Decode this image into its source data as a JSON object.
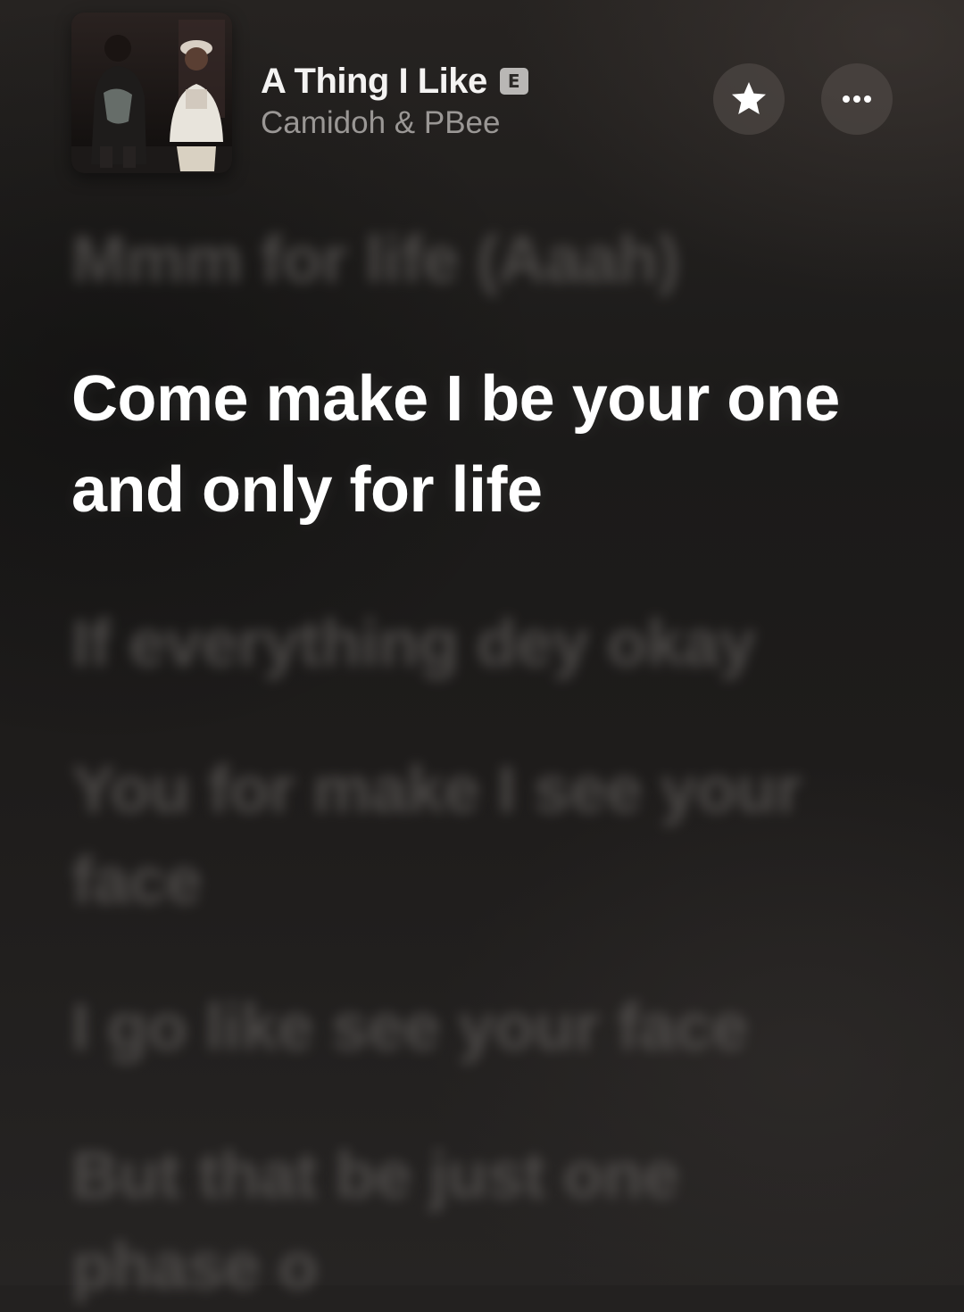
{
  "now_playing": {
    "title": "A Thing I Like",
    "explicit_label": "E",
    "artist": "Camidoh & PBee"
  },
  "actions": {
    "favorite_icon": "star-icon",
    "more_icon": "ellipsis-icon"
  },
  "lyrics": {
    "lines": [
      "Mmm for life (Aaah)",
      "Come make I be your one and only for life",
      "If everything dey okay",
      "You for make I see your face",
      "I go like see your face",
      "But that be just one phase o"
    ],
    "active_index": 1
  }
}
